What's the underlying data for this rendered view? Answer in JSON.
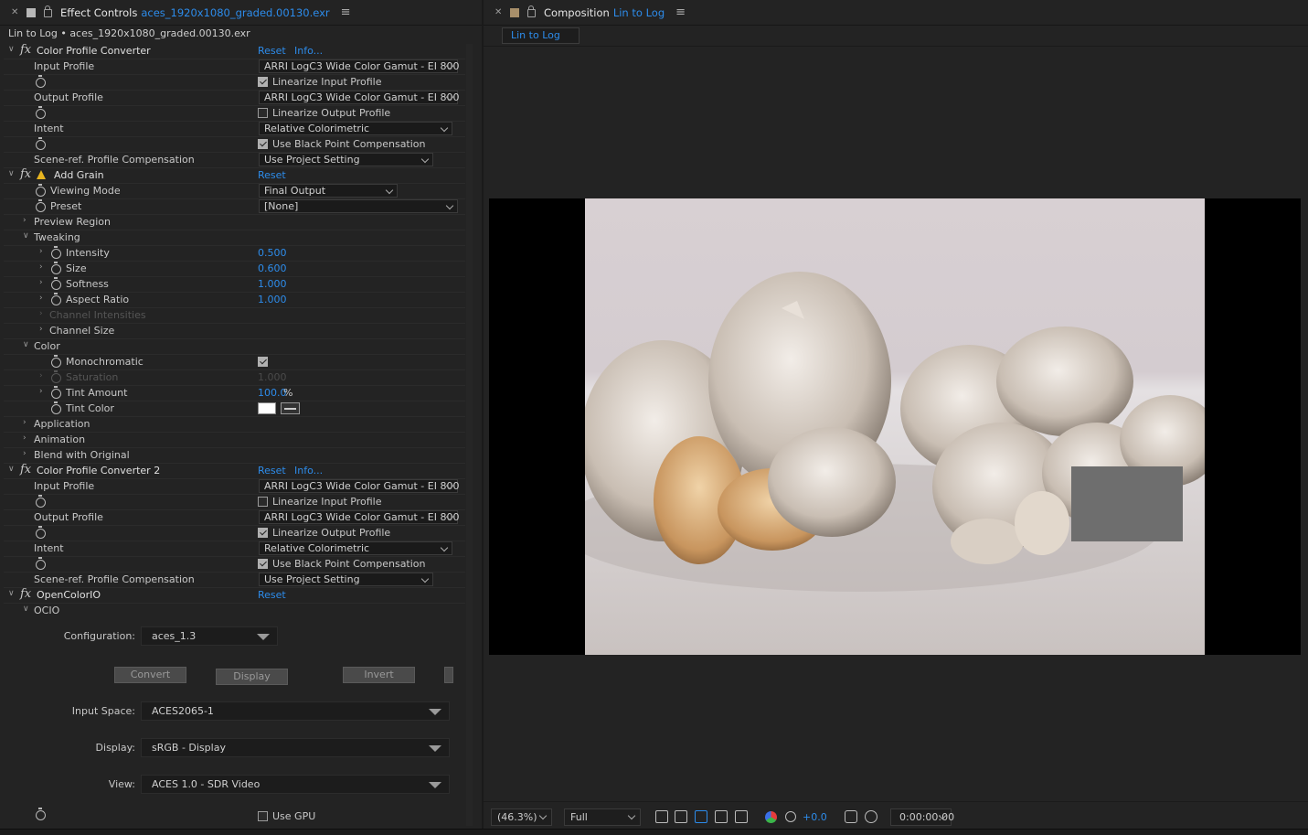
{
  "left_panel": {
    "title": "Effect Controls",
    "file": "aces_1920x1080_graded.00130.exr",
    "subtitle": "Lin to Log • aces_1920x1080_graded.00130.exr"
  },
  "cpc1": {
    "name": "Color Profile Converter",
    "reset": "Reset",
    "info": "Info...",
    "input_profile_label": "Input Profile",
    "input_profile": "ARRI LogC3 Wide Color Gamut - EI 800",
    "linearize_input": "Linearize Input Profile",
    "output_profile_label": "Output Profile",
    "output_profile": "ARRI LogC3 Wide Color Gamut - EI 800",
    "linearize_output": "Linearize Output Profile",
    "intent_label": "Intent",
    "intent": "Relative Colorimetric",
    "black_point": "Use Black Point Compensation",
    "scene_ref_label": "Scene-ref. Profile Compensation",
    "scene_ref": "Use Project Setting"
  },
  "grain": {
    "name": "Add Grain",
    "reset": "Reset",
    "viewing_mode_label": "Viewing Mode",
    "viewing_mode": "Final Output",
    "preset_label": "Preset",
    "preset": "[None]",
    "preview_region": "Preview Region",
    "tweaking": "Tweaking",
    "intensity_label": "Intensity",
    "intensity": "0.500",
    "size_label": "Size",
    "size": "0.600",
    "softness_label": "Softness",
    "softness": "1.000",
    "aspect_label": "Aspect Ratio",
    "aspect": "1.000",
    "channel_intensities": "Channel Intensities",
    "channel_size": "Channel Size",
    "color": "Color",
    "monochromatic": "Monochromatic",
    "saturation_label": "Saturation",
    "saturation": "1.000",
    "tint_amount_label": "Tint Amount",
    "tint_amount": "100.0",
    "tint_unit": "%",
    "tint_color_label": "Tint Color",
    "application": "Application",
    "animation": "Animation",
    "blend": "Blend with Original"
  },
  "cpc2": {
    "name": "Color Profile Converter 2",
    "reset": "Reset",
    "info": "Info...",
    "input_profile_label": "Input Profile",
    "input_profile": "ARRI LogC3 Wide Color Gamut - EI 800",
    "linearize_input": "Linearize Input Profile",
    "output_profile_label": "Output Profile",
    "output_profile": "ARRI LogC3 Wide Color Gamut - EI 800",
    "linearize_output": "Linearize Output Profile",
    "intent_label": "Intent",
    "intent": "Relative Colorimetric",
    "black_point": "Use Black Point Compensation",
    "scene_ref_label": "Scene-ref. Profile Compensation",
    "scene_ref": "Use Project Setting"
  },
  "ocio": {
    "name": "OpenColorIO",
    "reset": "Reset",
    "group": "OCIO",
    "config_label": "Configuration:",
    "config": "aces_1.3",
    "convert": "Convert",
    "display_btn": "Display",
    "invert": "Invert",
    "input_space_label": "Input Space:",
    "input_space": "ACES2065-1",
    "display_label": "Display:",
    "display": "sRGB - Display",
    "view_label": "View:",
    "view": "ACES 1.0 - SDR Video",
    "use_gpu": "Use GPU"
  },
  "right_panel": {
    "title": "Composition",
    "comp": "Lin to Log",
    "tab": "Lin to Log",
    "zoom": "(46.3%)",
    "resolution": "Full",
    "exposure": "+0.0",
    "timecode": "0:00:00:00"
  }
}
